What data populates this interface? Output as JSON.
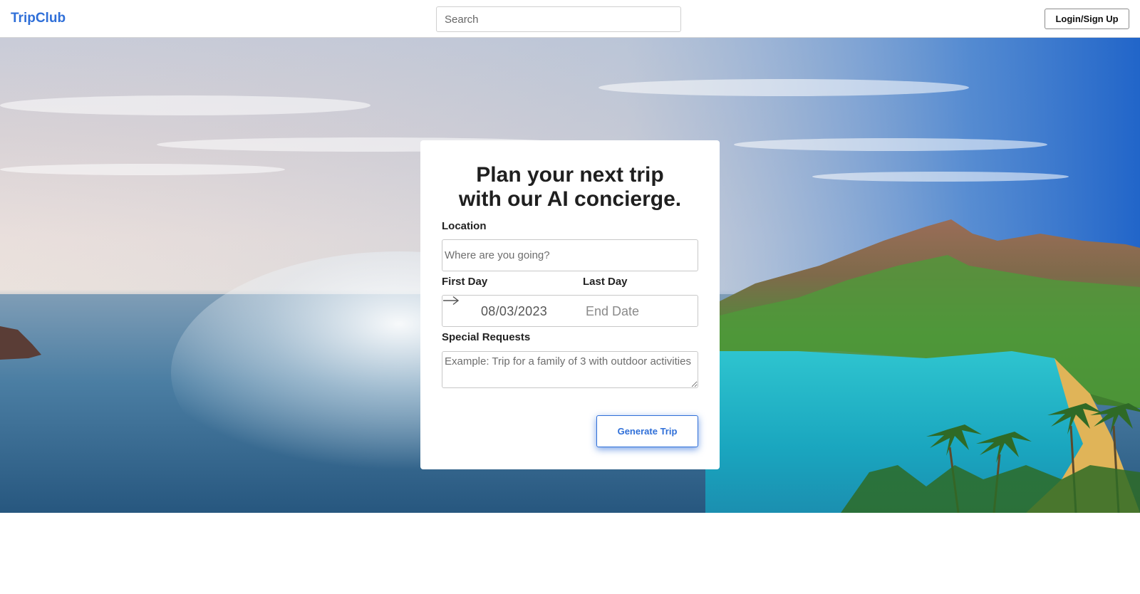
{
  "header": {
    "brand": "TripClub",
    "search_placeholder": "Search",
    "login_label": "Login/Sign Up"
  },
  "planner": {
    "title_line1": "Plan your next trip",
    "title_line2": "with our AI concierge.",
    "location_label": "Location",
    "location_placeholder": "Where are you going?",
    "first_day_label": "First Day",
    "last_day_label": "Last Day",
    "start_date_value": "08/03/2023",
    "end_date_placeholder": "End Date",
    "requests_label": "Special Requests",
    "requests_placeholder": "Example: Trip for a family of 3 with outdoor activities",
    "generate_label": "Generate Trip"
  },
  "colors": {
    "brand": "#2f6fd8",
    "button_glow": "#2f6fd8"
  },
  "icons": {
    "date_separator": "arrow-right-icon"
  }
}
